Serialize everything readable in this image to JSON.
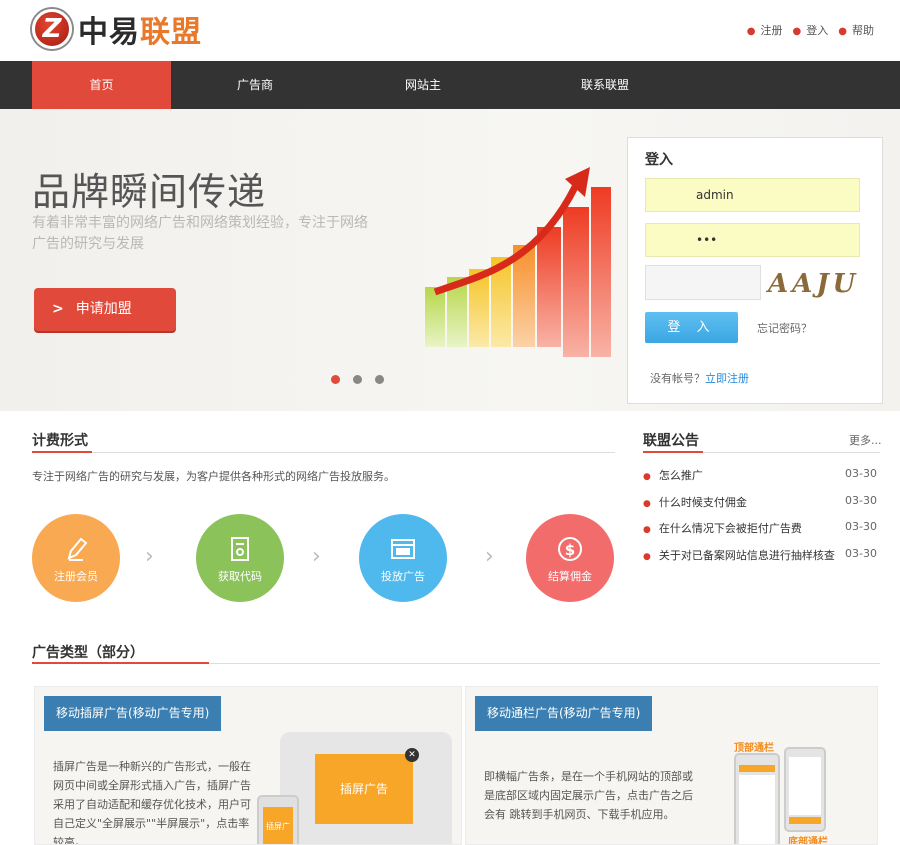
{
  "header": {
    "logo_mark": "Z",
    "logo_dark": "中易",
    "logo_accent": "联盟",
    "links": [
      "注册",
      "登入",
      "帮助"
    ]
  },
  "nav": {
    "items": [
      "首页",
      "广告商",
      "网站主",
      "联系联盟"
    ],
    "active_index": 0
  },
  "banner": {
    "title": "品牌瞬间传递",
    "subtitle": "有着非常丰富的网络广告和网络策划经验，专注于网络广告的研究与发展",
    "apply_label": "申请加盟",
    "slide_count": 3,
    "active_slide": 0
  },
  "login": {
    "title": "登入",
    "username_value": "admin",
    "password_value": "•••",
    "captcha_text": "AAJU",
    "login_label": "登 入",
    "forgot_label": "忘记密码？",
    "no_account_label": "没有帐号？",
    "register_label": "立即注册"
  },
  "billing": {
    "title": "计费形式",
    "description": "专注于网络广告的研究与发展，为客户提供各种形式的网络广告投放服务。",
    "steps": [
      {
        "label": "注册会员",
        "color": "#f9a951",
        "icon": "pencil-icon"
      },
      {
        "label": "获取代码",
        "color": "#8bc35a",
        "icon": "code-document-icon"
      },
      {
        "label": "投放广告",
        "color": "#4fb9ee",
        "icon": "browser-window-icon"
      },
      {
        "label": "结算佣金",
        "color": "#f26c6c",
        "icon": "dollar-coin-icon"
      }
    ]
  },
  "notices": {
    "title": "联盟公告",
    "more_label": "更多...",
    "items": [
      {
        "text": "怎么推广",
        "date": "03-30"
      },
      {
        "text": "什么时候支付佣金",
        "date": "03-30"
      },
      {
        "text": "在什么情况下会被拒付广告费",
        "date": "03-30"
      },
      {
        "text": "关于对已备案网站信息进行抽样核查",
        "date": "03-30"
      }
    ]
  },
  "ad_types": {
    "title": "广告类型（部分）",
    "cards": [
      {
        "tag": "移动插屏广告(移动广告专用)",
        "text": "插屏广告是一种新兴的广告形式，一般在网页中间或全屏形式插入广告，插屏广告采用了自动适配和缓存优化技术，用户可自己定义\"全屏展示\"\"半屏展示\"，点击率较高。",
        "illustration_label": "插屏广告",
        "small_label": "插屏广告"
      },
      {
        "tag": "移动通栏广告(移动广告专用)",
        "text": "即横幅广告条，是在一个手机网站的顶部或是底部区域内固定展示广告，点击广告之后会有 跳转到手机网页、下载手机应用。",
        "top_label": "顶部通栏",
        "bottom_label": "底部通栏"
      }
    ]
  },
  "colors": {
    "accent_red": "#e14a3b",
    "nav_bg": "#333333",
    "tag_blue": "#3b7fb2",
    "login_blue": "#3aa6e2"
  }
}
